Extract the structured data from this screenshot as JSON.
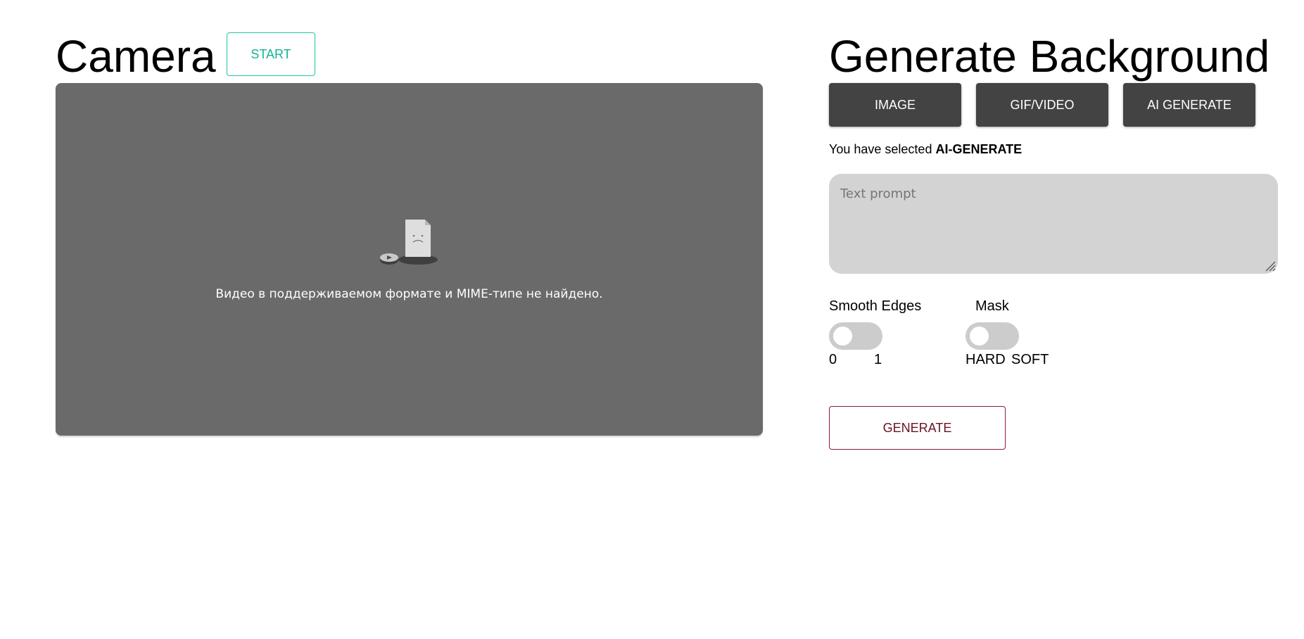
{
  "camera": {
    "title": "Camera",
    "start_label": "START",
    "video_error": "Видео в поддерживаемом формате и MIME-типе не найдено.",
    "video_bg": "#6a6a6a"
  },
  "generate": {
    "title": "Generate Background",
    "modes": [
      {
        "label": "IMAGE"
      },
      {
        "label": "GIF/VIDEO"
      },
      {
        "label": "AI GENERATE"
      }
    ],
    "selected_prefix": "You have selected",
    "selected_value": "AI-GENERATE",
    "prompt_placeholder": "Text prompt",
    "prompt_value": "",
    "smooth_edges": {
      "label": "Smooth Edges",
      "min_label": "0",
      "max_label": "1",
      "on": false
    },
    "mask": {
      "label": "Mask",
      "min_label": "HARD",
      "max_label": "SOFT",
      "on": false
    },
    "generate_label": "GENERATE"
  },
  "colors": {
    "start_accent": "#1ec6a4",
    "mode_button_bg": "#434343",
    "generate_accent": "#8a1c34",
    "toggle_off": "#cccccc"
  },
  "icons": {
    "broken_video": "broken-video-icon",
    "resize_grip": "resize-grip-icon"
  }
}
